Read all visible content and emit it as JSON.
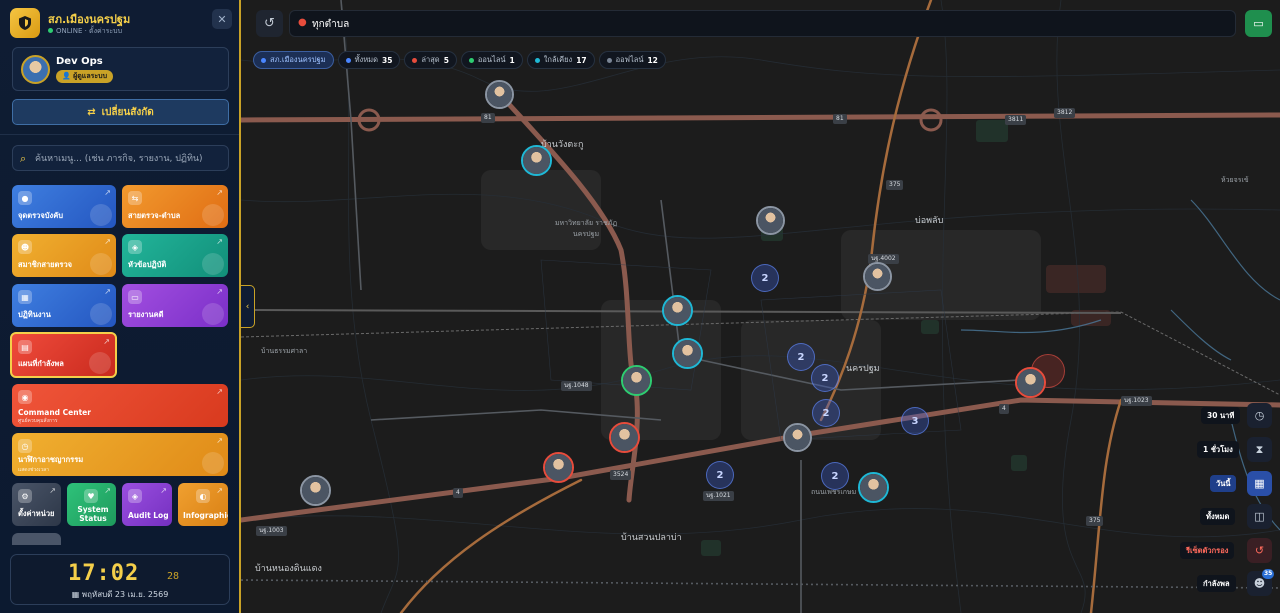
{
  "sidebar": {
    "brand_title": "สภ.เมืองนครปฐม",
    "brand_status": "ONLINE · ตั้งค่าระบบ",
    "user_name": "Dev Ops",
    "user_role": "ผู้ดูแลระบบ",
    "switch_label": "เปลี่ยนสังกัด",
    "search_placeholder": "ค้นหาเมนู... (เช่น ภารกิจ, รายงาน, ปฏิทิน)",
    "tiles": [
      {
        "label": "จุดตรวจบังคับ",
        "color_from": "#3f7fe0",
        "color_to": "#2456c0"
      },
      {
        "label": "สายตรวจ-ตำบล",
        "color_from": "#f29a2e",
        "color_to": "#e06d14"
      },
      {
        "label": "สมาชิกสายตรวจ",
        "color_from": "#f0b030",
        "color_to": "#e08a18"
      },
      {
        "label": "หัวข้อปฏิบัติ",
        "color_from": "#22b59a",
        "color_to": "#128f7a"
      },
      {
        "label": "ปฏิทินงาน",
        "color_from": "#3f7fe0",
        "color_to": "#2456c0"
      },
      {
        "label": "รายงานคดี",
        "color_from": "#a24fe0",
        "color_to": "#7b2fc8"
      },
      {
        "label": "แผนที่กำลังพล",
        "color_from": "#ef4b3b",
        "color_to": "#c92a1e"
      },
      {
        "label": "Command Center",
        "sub": "ศูนย์ควบคุมสั่งการ",
        "color_from": "#f0553a",
        "color_to": "#d83a1e"
      },
      {
        "label": "นาฬิกาอาชญากรรม",
        "sub": "แสดงช่วงเวลา",
        "color_from": "#f0b030",
        "color_to": "#e08a18"
      },
      {
        "label": "ตั้งค่าหน่วย",
        "color_from": "#4a5568",
        "color_to": "#2d3748"
      },
      {
        "label": "System Status",
        "color_from": "#2ec27a",
        "color_to": "#1e9a5c"
      },
      {
        "label": "Audit Log",
        "color_from": "#9a4fe0",
        "color_to": "#7530c0"
      },
      {
        "label": "Infographic",
        "color_from": "#f0a030",
        "color_to": "#d98014"
      }
    ],
    "clock_time": "17:02",
    "clock_seconds": "28",
    "clock_date": "พฤหัสบดี 23 เม.ย. 2569"
  },
  "map": {
    "search_text": "ทุกตำบล",
    "filters": [
      {
        "label": "สภ.เมืองนครปฐม",
        "count": "",
        "dot": "#4a86ff",
        "active": true
      },
      {
        "label": "ทั้งหมด",
        "count": "35",
        "dot": "#4a86ff",
        "active": false
      },
      {
        "label": "ล่าสุด",
        "count": "5",
        "dot": "#e74c3c",
        "active": false
      },
      {
        "label": "ออนไลน์",
        "count": "1",
        "dot": "#2ecc71",
        "active": false
      },
      {
        "label": "ใกล้เคียง",
        "count": "17",
        "dot": "#1fb8d6",
        "active": false
      },
      {
        "label": "ออฟไลน์",
        "count": "12",
        "dot": "#7a8595",
        "active": false
      }
    ],
    "controls": {
      "time_30": "30 นาที",
      "time_1h": "1 ชั่วโมง",
      "today": "วันนี้",
      "all": "ทั้งหมด",
      "reset": "รีเซ็ตตัวกรอง",
      "force": "กำลังพล",
      "force_count": "35"
    },
    "cluster_labels": [
      "2",
      "2",
      "2",
      "2",
      "3",
      "2",
      "2",
      "3"
    ],
    "labels": {
      "place1": "บ้านวังตะกู",
      "place2": "มหาวิทยาลัย ราชภัฏนครปฐม",
      "place3": "บ่อพลับ",
      "place4": "นครปฐม",
      "place5": "บ้านสวนปลาบ่า",
      "place6": "บ้านหนองดินแดง",
      "place7": "บ้านธรรมศาลา",
      "place8": "ห้วยจรเข้",
      "road1": "81",
      "road2": "3811",
      "road3": "3812",
      "road4": "375",
      "road5": "3524",
      "road6": "4",
      "road7": "นฐ.1048",
      "road8": "นฐ.1021",
      "road9": "นฐ.1003",
      "road10": "นฐ.1023",
      "road11": "นฐ.4002",
      "road12": "ถนนเพชรเกษม"
    }
  }
}
